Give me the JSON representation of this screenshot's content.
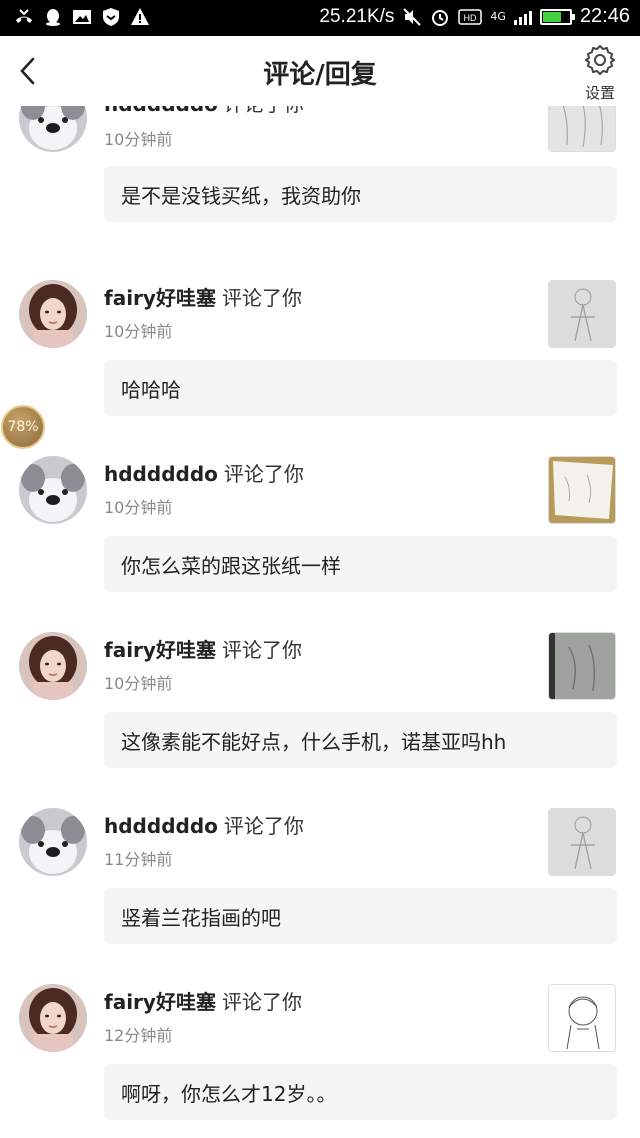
{
  "status_bar": {
    "net_speed": "25.21K/s",
    "network": "4G",
    "time": "22:46",
    "battery_level": 0.7,
    "icons": [
      "missed-call-icon",
      "qq-icon",
      "image-icon",
      "shield-icon",
      "warning-icon"
    ]
  },
  "header": {
    "title": "评论/回复",
    "settings_label": "设置"
  },
  "floating_badge": "78%",
  "comments": [
    {
      "name": "hddddddo",
      "verb": "评论了你",
      "time": "10分钟前",
      "text": "是不是没钱买纸，我资助你",
      "avatar": "husky",
      "thumb": "sketch-light"
    },
    {
      "name": "fairy好哇塞",
      "verb": "评论了你",
      "time": "10分钟前",
      "text": "哈哈哈",
      "avatar": "girl",
      "thumb": "sketch-figure"
    },
    {
      "name": "hddddddo",
      "verb": "评论了你",
      "time": "10分钟前",
      "text": "你怎么菜的跟这张纸一样",
      "avatar": "husky",
      "thumb": "paper-on-table"
    },
    {
      "name": "fairy好哇塞",
      "verb": "评论了你",
      "time": "10分钟前",
      "text": "这像素能不能好点，什么手机，诺基亚吗hh",
      "avatar": "girl",
      "thumb": "sketch-dark"
    },
    {
      "name": "hddddddo",
      "verb": "评论了你",
      "time": "11分钟前",
      "text": "竖着兰花指画的吧",
      "avatar": "husky",
      "thumb": "sketch-figure"
    },
    {
      "name": "fairy好哇塞",
      "verb": "评论了你",
      "time": "12分钟前",
      "text": "啊呀，你怎么才12岁。。",
      "avatar": "girl",
      "thumb": "line-drawing"
    }
  ]
}
